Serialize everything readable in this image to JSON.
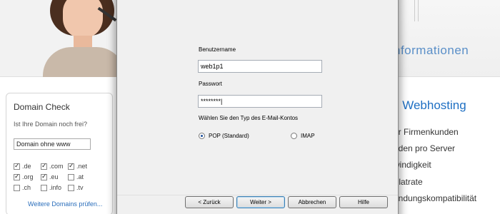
{
  "header": {
    "right_watermark": "nformationen"
  },
  "domain_check": {
    "title": "Domain Check",
    "question": "Ist Ihre Domain noch frei?",
    "input_value": "Domain ohne www",
    "tlds": [
      {
        "label": ".de",
        "checked": true
      },
      {
        "label": ".com",
        "checked": true
      },
      {
        "label": ".net",
        "checked": true
      },
      {
        "label": ".org",
        "checked": true
      },
      {
        "label": ".eu",
        "checked": true
      },
      {
        "label": ".at",
        "checked": false
      },
      {
        "label": ".ch",
        "checked": false
      },
      {
        "label": ".info",
        "checked": false
      },
      {
        "label": ".tv",
        "checked": false
      }
    ],
    "more_link": "Weitere Domains prüfen..."
  },
  "webhosting": {
    "title": "s Webhosting",
    "features": [
      "ür Firmenkunden",
      "nden pro Server",
      "windigkeit",
      "Flatrate",
      "endungskompatibilität"
    ]
  },
  "dialog": {
    "username_label": "Benutzername",
    "username_value": "web1p1",
    "password_label": "Passwort",
    "password_value": "********|",
    "account_type_label": "Wählen Sie den Typ des E-Mail-Kontos",
    "radio_pop": "POP (Standard)",
    "radio_imap": "IMAP",
    "selected_type": "POP (Standard)",
    "buttons": {
      "back": "< Zurück",
      "next": "Weiter >",
      "cancel": "Abbrechen",
      "help": "Hilfe"
    }
  },
  "colors": {
    "link": "#2a6ebb",
    "heading_blue": "#1e6fc3",
    "dialog_bg": "#f0f0f0"
  }
}
